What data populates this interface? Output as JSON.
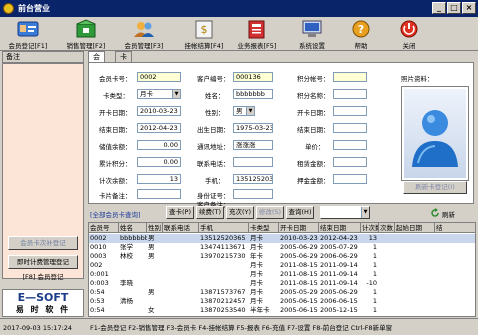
{
  "window": {
    "title": "前台营业"
  },
  "toolbar": [
    {
      "label": "会员登记[F1]",
      "icon": "member-card-icon"
    },
    {
      "label": "销售管理[F2]",
      "icon": "sales-box-icon"
    },
    {
      "label": "会员管理[F3]",
      "icon": "member-manage-icon"
    },
    {
      "label": "挂帐结算[F4]",
      "icon": "money-bag-icon"
    },
    {
      "label": "业务报表[F5]",
      "icon": "report-book-icon"
    },
    {
      "label": "系统设置",
      "icon": "computer-icon"
    },
    {
      "label": "帮助",
      "icon": "help-icon"
    },
    {
      "label": "关闭",
      "icon": "close-power-icon"
    }
  ],
  "left": {
    "header": "备注",
    "btn1": "会员卡次补登记",
    "btn2": "即时计费管理登记",
    "btn3": "[F8] 会员登记",
    "logo": "E—SOFT",
    "logo_sub": "易 时 软 件"
  },
  "tabs": [
    "会员",
    "卡信"
  ],
  "form": {
    "card_no_label": "会员卡号：",
    "card_no": "0002",
    "card_type_label": "卡类型：",
    "card_type": "月卡",
    "open_date_label": "开卡日期：",
    "open_date": "2010-03-23",
    "end_date_label": "结束日期：",
    "end_date": "2012-04-23",
    "balance_label": "储值余额：",
    "balance": "0.00",
    "total_spent_label": "累计积分：",
    "total_spent": "0.00",
    "visits_label": "计次余额：",
    "visits": "13",
    "note_label": "卡片备注：",
    "cust_no_label": "客户编号：",
    "cust_no": "000136",
    "name_label": "姓名：",
    "name": "bbbbbbb",
    "gender_label": "性别：",
    "gender": "男",
    "birth_label": "出生日期：",
    "birth": "1975-03-23",
    "address_label": "通讯地址：",
    "address": "涨涨涨",
    "phone_label": "联系电话：",
    "mobile_label": "手机：",
    "mobile": "13512520365",
    "id_label": "身份证号：",
    "cust_note_label": "客户备注：",
    "jobno_label": "积分帐号：",
    "car_label": "积分名称：",
    "shop_label": "开卡日期：",
    "last_label": "结束日期：",
    "unit_label": "单价：",
    "deposit_label": "租赁金额：",
    "pledge_label": "押金金额：",
    "photo_label": "照片资料：",
    "photo_btn": "刷新卡登记(I)"
  },
  "actions": {
    "query_all": "[全部会员卡查询]",
    "delete": "查卡(P)",
    "modify": "续费(T)",
    "charge": "充次(Y)",
    "edit": "修改(S)",
    "query": "查询(H)",
    "refresh": "刷新"
  },
  "grid": {
    "headers": [
      "会员号",
      "姓名",
      "性别",
      "联系电话",
      "手机",
      "卡类型",
      "开卡日期",
      "结束日期",
      "计次数",
      "次数",
      "起始日期",
      "结"
    ],
    "rows": [
      [
        "0002",
        "bbbbbbb",
        "男",
        "",
        "13512520365",
        "月卡",
        "2010-03-23",
        "2012-04-23",
        "13",
        "",
        "",
        ""
      ],
      [
        "0010",
        "张学",
        "男",
        "",
        "13474113671",
        "月卡",
        "2005-06-29",
        "2005-07-29",
        "1",
        "",
        "",
        ""
      ],
      [
        "0003",
        "林校",
        "男",
        "",
        "13970215730",
        "年卡",
        "2005-06-29",
        "2006-06-29",
        "1",
        "",
        "",
        ""
      ],
      [
        "002",
        "",
        "",
        "",
        "",
        "月卡",
        "2011-08-15",
        "2011-09-14",
        "1",
        "",
        "",
        ""
      ],
      [
        "0:001",
        "",
        "",
        "",
        "",
        "月卡",
        "2011-08-15",
        "2011-09-14",
        "1",
        "",
        "",
        ""
      ],
      [
        "0:003",
        "李晓",
        "",
        "",
        "",
        "月卡",
        "2011-08-15",
        "2011-09-14",
        "-10",
        "",
        "",
        ""
      ],
      [
        "0:54",
        "",
        "男",
        "",
        "13871573767",
        "月卡",
        "2005-05-29",
        "2005-06-29",
        "1",
        "",
        "",
        ""
      ],
      [
        "0:53",
        "清杨",
        "",
        "",
        "13870212457",
        "月卡",
        "2005-06-15",
        "2006-06-15",
        "1",
        "",
        "",
        ""
      ],
      [
        "0:54",
        "",
        "女",
        "",
        "13870253540",
        "半年卡",
        "2005-06-15",
        "2005-12-15",
        "1",
        "",
        "",
        ""
      ]
    ]
  },
  "status": {
    "datetime": "2017-09-03 15:17:24",
    "hint": "F1-会员登记 F2-销售管理 F3-会员卡 F4-挂帐结算 F5-报表 F6-充值 F7-设置 F8-前台登记 Ctrl-F8新单窗"
  }
}
